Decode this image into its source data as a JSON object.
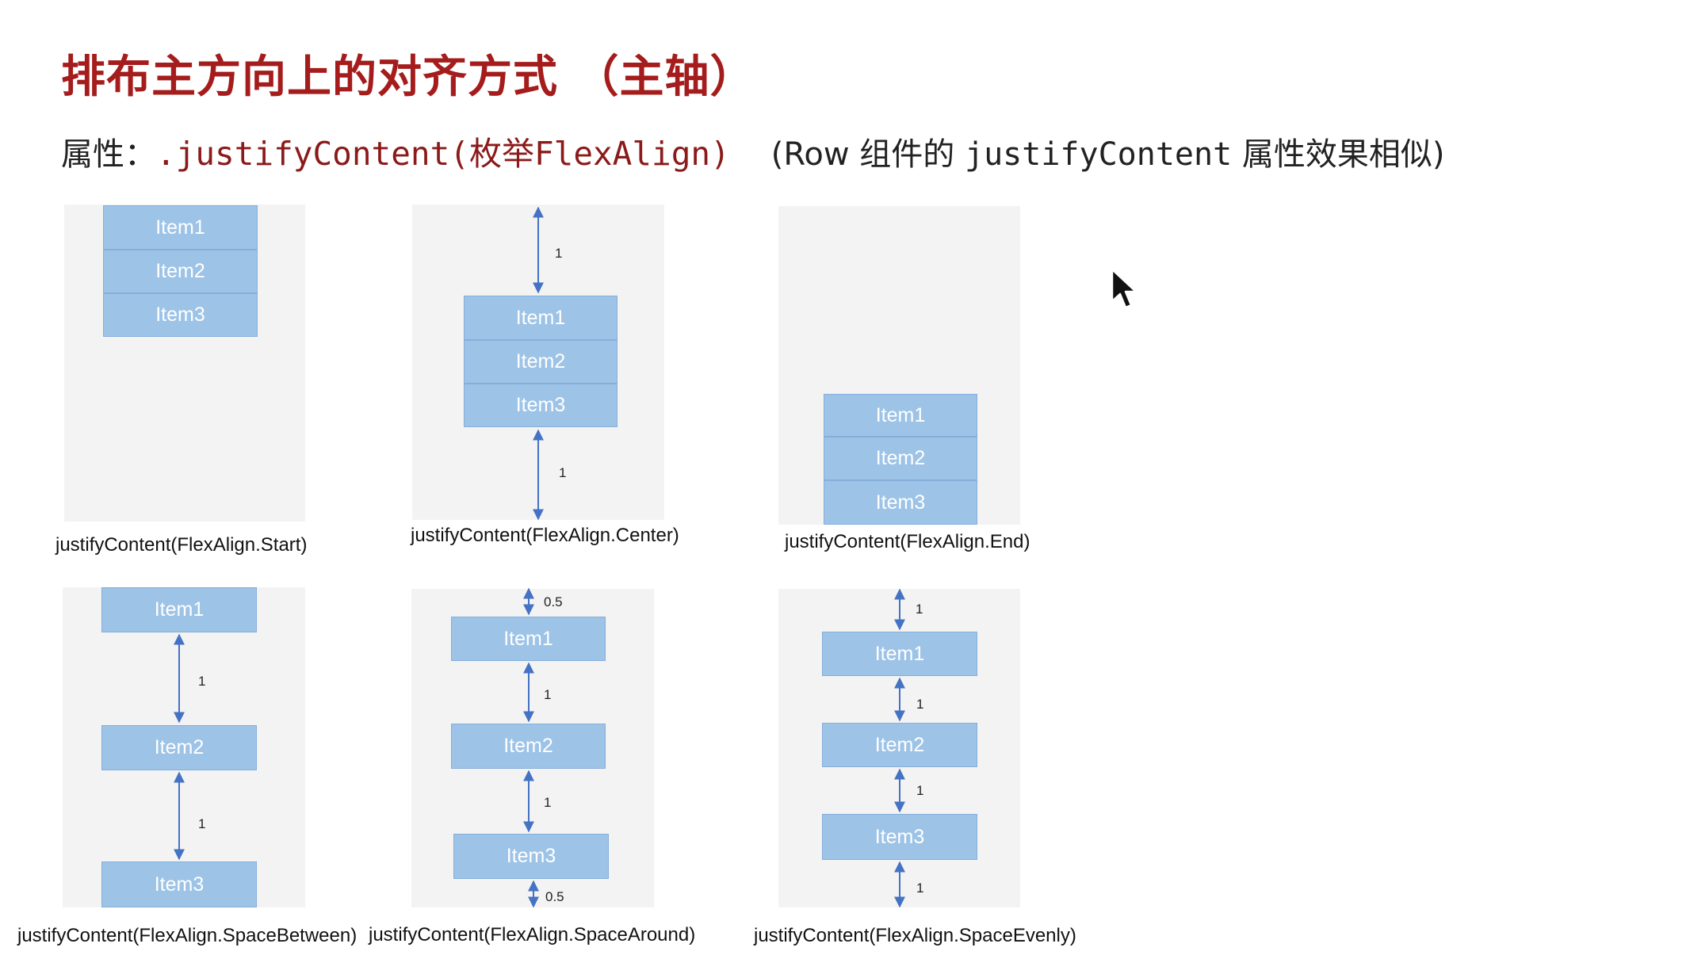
{
  "title": "排布主方向上的对齐方式 （主轴）",
  "subtitle": {
    "label": "属性：",
    "code": ".justifyContent(枚举FlexAlign)",
    "note_open": "(Row 组件的 ",
    "note_code": "justifyContent",
    "note_close": " 属性效果相似)"
  },
  "item_labels": [
    "Item1",
    "Item2",
    "Item3"
  ],
  "diagrams": [
    {
      "caption": "justifyContent(FlexAlign.Start)",
      "gap_labels": []
    },
    {
      "caption": "justifyContent(FlexAlign.Center)",
      "gap_labels": [
        "1",
        "1"
      ]
    },
    {
      "caption": "justifyContent(FlexAlign.End)",
      "gap_labels": []
    },
    {
      "caption": "justifyContent(FlexAlign.SpaceBetween)",
      "gap_labels": [
        "1",
        "1"
      ]
    },
    {
      "caption": "justifyContent(FlexAlign.SpaceAround)",
      "gap_labels": [
        "0.5",
        "1",
        "1",
        "0.5"
      ]
    },
    {
      "caption": "justifyContent(FlexAlign.SpaceEvenly)",
      "gap_labels": [
        "1",
        "1",
        "1",
        "1"
      ]
    }
  ],
  "colors": {
    "title": "#a51c1c",
    "code": "#8b1a1a",
    "item_fill": "#9dc3e6",
    "panel": "#f3f3f3",
    "arrow": "#4472c4"
  },
  "cursor_icon": "mouse-pointer-icon"
}
